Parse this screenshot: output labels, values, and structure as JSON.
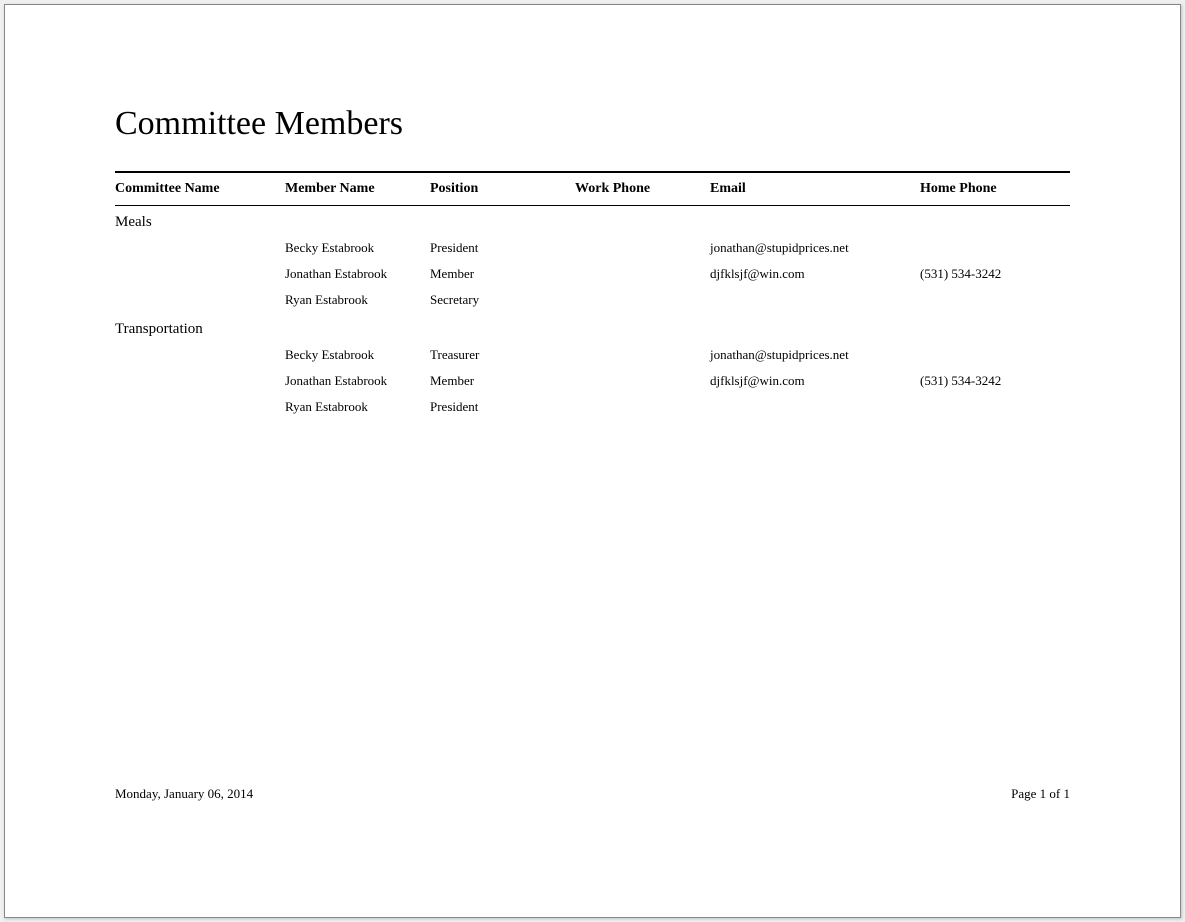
{
  "report": {
    "title": "Committee Members",
    "columns": {
      "committee": "Committee Name",
      "member": "Member Name",
      "position": "Position",
      "work_phone": "Work Phone",
      "email": "Email",
      "home_phone": "Home Phone"
    },
    "groups": [
      {
        "committee_name": "Meals",
        "rows": [
          {
            "member": "Becky Estabrook",
            "position": "President",
            "work_phone": "",
            "email": "jonathan@stupidprices.net",
            "home_phone": ""
          },
          {
            "member": "Jonathan Estabrook",
            "position": "Member",
            "work_phone": "",
            "email": "djfklsjf@win.com",
            "home_phone": "(531) 534-3242"
          },
          {
            "member": "Ryan Estabrook",
            "position": "Secretary",
            "work_phone": "",
            "email": "",
            "home_phone": ""
          }
        ]
      },
      {
        "committee_name": "Transportation",
        "rows": [
          {
            "member": "Becky Estabrook",
            "position": "Treasurer",
            "work_phone": "",
            "email": "jonathan@stupidprices.net",
            "home_phone": ""
          },
          {
            "member": "Jonathan Estabrook",
            "position": "Member",
            "work_phone": "",
            "email": "djfklsjf@win.com",
            "home_phone": "(531) 534-3242"
          },
          {
            "member": "Ryan Estabrook",
            "position": "President",
            "work_phone": "",
            "email": "",
            "home_phone": ""
          }
        ]
      }
    ],
    "footer": {
      "date": "Monday, January 06, 2014",
      "page": "Page 1 of 1"
    }
  }
}
